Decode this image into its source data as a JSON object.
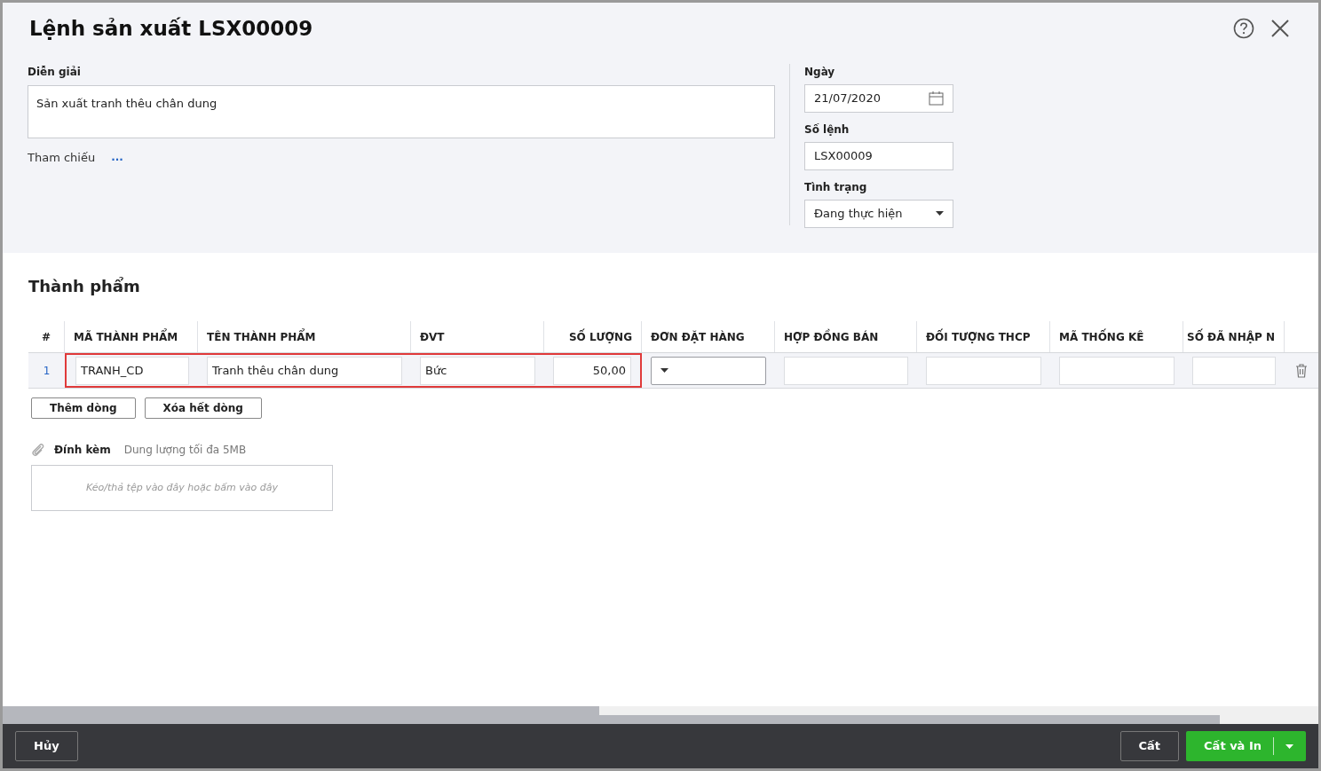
{
  "title": "Lệnh sản xuất LSX00009",
  "description": {
    "label": "Diễn giải",
    "value": "Sản xuất tranh thêu chân dung"
  },
  "reference": {
    "label": "Tham chiếu",
    "link": "..."
  },
  "date": {
    "label": "Ngày",
    "value": "21/07/2020"
  },
  "order_no": {
    "label": "Số lệnh",
    "value": "LSX00009"
  },
  "status": {
    "label": "Tình trạng",
    "value": "Đang thực hiện"
  },
  "section_title": "Thành phẩm",
  "table": {
    "columns": [
      {
        "label": "#"
      },
      {
        "label": "MÃ THÀNH PHẨM"
      },
      {
        "label": "TÊN THÀNH PHẨM"
      },
      {
        "label": "ĐVT"
      },
      {
        "label": "SỐ LƯỢNG"
      },
      {
        "label": "ĐƠN ĐẶT HÀNG"
      },
      {
        "label": "HỢP ĐỒNG BÁN"
      },
      {
        "label": "ĐỐI TƯỢNG THCP"
      },
      {
        "label": "MÃ THỐNG KÊ"
      },
      {
        "label": "SỐ ĐÃ NHẬP N"
      }
    ],
    "rows": [
      {
        "cells": [
          {
            "kind": "index",
            "value": "1",
            "highlighted": false
          },
          {
            "kind": "text",
            "value": "TRANH_CD",
            "highlighted": true
          },
          {
            "kind": "text",
            "value": "Tranh thêu chân dung",
            "highlighted": true
          },
          {
            "kind": "text",
            "value": "Bức",
            "highlighted": true
          },
          {
            "kind": "number",
            "value": "50,00",
            "highlighted": true
          },
          {
            "kind": "select",
            "highlighted": false
          },
          {
            "kind": "text",
            "highlighted": false
          },
          {
            "kind": "text",
            "highlighted": false
          },
          {
            "kind": "text",
            "highlighted": false
          },
          {
            "kind": "text",
            "highlighted": false
          }
        ]
      }
    ]
  },
  "row_buttons": [
    "Thêm dòng",
    "Xóa hết dòng"
  ],
  "attachment": {
    "label": "Đính kèm",
    "hint": "Dung lượng tối đa 5MB",
    "dropzone": "Kéo/thả tệp vào đây hoặc bấm vào đây"
  },
  "footer": {
    "cancel": "Hủy",
    "save": "Cất",
    "save_print": "Cất và In"
  }
}
